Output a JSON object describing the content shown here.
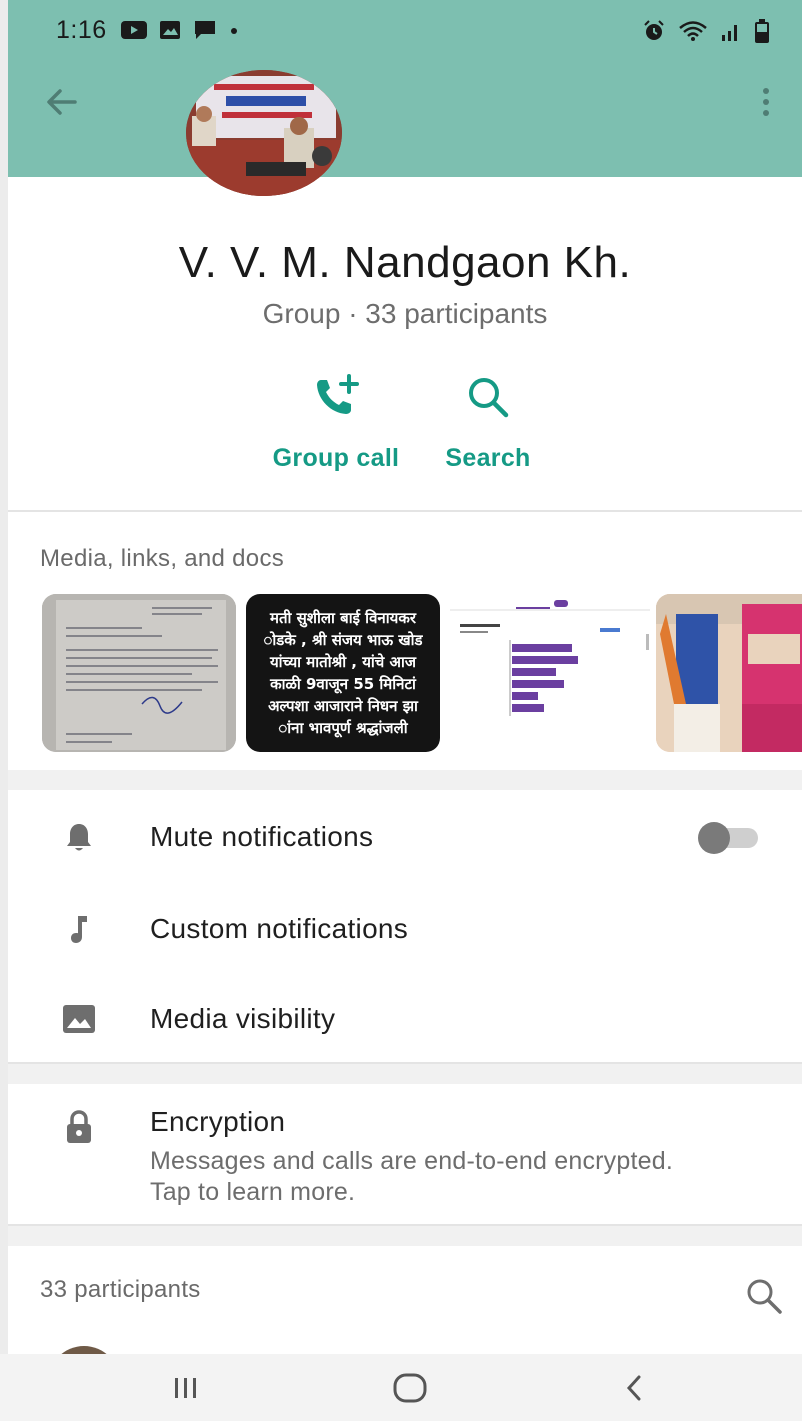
{
  "status_bar": {
    "time": "1:16"
  },
  "group": {
    "name": "V. V. M. Nandgaon Kh.",
    "subtitle": "Group · 33 participants"
  },
  "actions": [
    {
      "label": "Group call",
      "icon": "group-call-icon"
    },
    {
      "label": "Search",
      "icon": "search-icon"
    }
  ],
  "media": {
    "title": "Media, links, and docs",
    "thumb2_lines": [
      "मती सुशीला बाई विनायकर",
      "ोडके , श्री संजय भाऊ खोड",
      "यांच्या मातोश्री , यांचे आज",
      "काळी 9वाजून 55 मिनिटां",
      "अल्पशा आजाराने निधन झा",
      "ांना भावपूर्ण श्रद्धांजली"
    ]
  },
  "settings": {
    "mute": {
      "label": "Mute notifications",
      "enabled": false
    },
    "custom": {
      "label": "Custom notifications"
    },
    "media_visibility": {
      "label": "Media visibility"
    }
  },
  "encryption": {
    "title": "Encryption",
    "description": "Messages and calls are end-to-end encrypted. Tap to learn more."
  },
  "participants": {
    "title": "33 participants"
  },
  "colors": {
    "header": "#7dbfb0",
    "accent": "#159a85"
  }
}
